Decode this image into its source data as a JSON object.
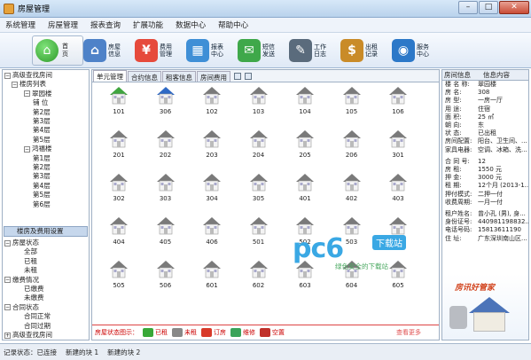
{
  "window": {
    "title": "房屋管理",
    "min": "–",
    "max": "□",
    "close": "✕"
  },
  "menu": [
    "系统管理",
    "房屋管理",
    "报表查询",
    "扩展功能",
    "数据中心",
    "帮助中心"
  ],
  "home": {
    "label": "首页"
  },
  "toolbar": [
    {
      "label": "房屋信息",
      "color": "#4e82c8",
      "glyph": "⌂"
    },
    {
      "label": "费用管理",
      "color": "#e64a3c",
      "glyph": "¥"
    },
    {
      "label": "报表中心",
      "color": "#3f8fd6",
      "glyph": "▦"
    },
    {
      "label": "短信发送",
      "color": "#3fa84a",
      "glyph": "✉"
    },
    {
      "label": "工作日志",
      "color": "#5a6b7c",
      "glyph": "✎"
    },
    {
      "label": "出租记录",
      "color": "#c98b28",
      "glyph": "$"
    },
    {
      "label": "服务中心",
      "color": "#2c78c8",
      "glyph": "◉"
    }
  ],
  "left_tree": {
    "root": "高级查找房间",
    "list_title": "楼房列表",
    "buildings": [
      {
        "name": "翠园楼",
        "items": [
          "铺 位",
          "第2层",
          "第3层",
          "第4层",
          "第5层"
        ]
      },
      {
        "name": "鸿福楼",
        "items": [
          "第1层",
          "第2层",
          "第3层",
          "第4层",
          "第5层",
          "第6层"
        ]
      }
    ],
    "settings_label": "楼房及费用设置",
    "status_groups": [
      {
        "name": "房屋状态",
        "items": [
          "全部",
          "已租",
          "未租"
        ]
      },
      {
        "name": "缴费情况",
        "items": [
          "已缴费",
          "未缴费"
        ]
      },
      {
        "name": "合同状态",
        "items": [
          "合同正常",
          "合同过期"
        ]
      }
    ],
    "bottom": "高级查找房间"
  },
  "tabs": [
    "单元管理",
    "合约信息",
    "租客信息",
    "房间费用"
  ],
  "rooms": [
    "101",
    "306",
    "102",
    "103",
    "104",
    "105",
    "106",
    "201",
    "202",
    "203",
    "204",
    "205",
    "206",
    "301",
    "302",
    "303",
    "304",
    "305",
    "401",
    "402",
    "403",
    "404",
    "405",
    "406",
    "501",
    "502",
    "503",
    "504",
    "505",
    "506",
    "601",
    "602",
    "603",
    "604",
    "605"
  ],
  "room_colors": {
    "101": "#3fa53f",
    "306": "#2f69c5"
  },
  "legend": {
    "title": "房屋状态图示：",
    "items": [
      {
        "label": "已租",
        "color": "#38a838"
      },
      {
        "label": "未租",
        "color": "#888"
      },
      {
        "label": "订房",
        "color": "#d83a2a"
      },
      {
        "label": "维修",
        "color": "#3aa35a"
      },
      {
        "label": "空置",
        "color": "#c0302a"
      }
    ],
    "more": "查看更多"
  },
  "right_panel": {
    "headers": [
      "房间信息",
      "信息内容"
    ],
    "rows1": [
      [
        "楼 名 称:",
        "翠园楼"
      ],
      [
        "房    名:",
        "308"
      ],
      [
        "房    型:",
        "一房一厅"
      ],
      [
        "用    途:",
        "住宿"
      ],
      [
        "面    积:",
        "25 ㎡"
      ],
      [
        "朝    向:",
        "东"
      ],
      [
        "状    态:",
        "已出租"
      ],
      [
        "房间配置:",
        "阳台、卫生间、..."
      ],
      [
        "家具电器:",
        "空调、冰箱、洗..."
      ]
    ],
    "rows2": [
      [
        "合 同 号:",
        "12"
      ],
      [
        "房    租:",
        "1550 元"
      ],
      [
        "押    金:",
        "3000 元"
      ],
      [
        "租    期:",
        "12个月 (2013-1..."
      ],
      [
        "押付模式:",
        "二押一付"
      ],
      [
        "收费周期:",
        "一月一付"
      ]
    ],
    "rows3": [
      [
        "租户姓名:",
        "曾小孔 (男), 身..."
      ],
      [
        "身份证号:",
        "440981198832..."
      ],
      [
        "电话号码:",
        "15813611190"
      ],
      [
        "住    址:",
        "广东深圳南山区..."
      ]
    ],
    "promo": "房讯好管家"
  },
  "status": [
    "记录状态：已连接",
    "新建的块 1",
    "新建的块 2"
  ],
  "watermark": {
    "brand": "pc6",
    "badge": "下载站",
    "sub": "绿色安全的下载站"
  }
}
